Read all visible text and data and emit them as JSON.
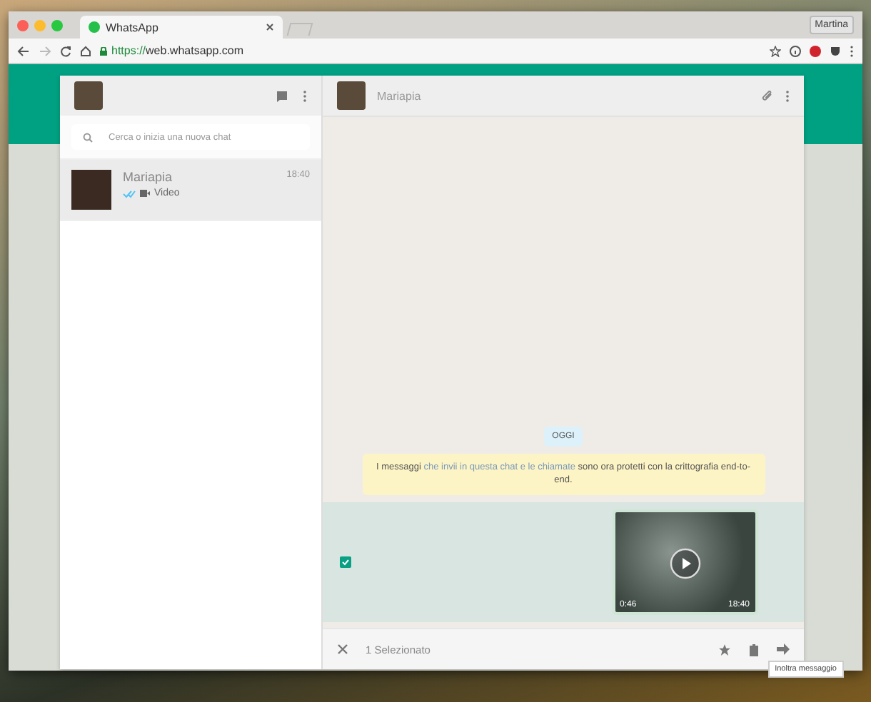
{
  "browser": {
    "tab_title": "WhatsApp",
    "profile": "Martina",
    "url_scheme": "https://",
    "url_host": "web.whatsapp.com"
  },
  "sidebar": {
    "search": {
      "placeholder": "Cerca o inizia una nuova chat"
    },
    "chats": [
      {
        "name": "Mariapia",
        "time": "18:40",
        "preview": "Video",
        "selected": true
      }
    ]
  },
  "chat": {
    "contact": "Mariapia",
    "date_badge": "OGGI",
    "notice": {
      "before": "I messaggi ",
      "link": "che invii in questa chat e le chiamate",
      "after": " sono ora protetti con la crittografia end-to-end."
    },
    "video": {
      "duration": "0:46",
      "time": "18:40",
      "checked": true,
      "selected": true
    },
    "selection_bar": {
      "label": "1 Selezionato",
      "tooltip": "Inoltra messaggio"
    }
  }
}
